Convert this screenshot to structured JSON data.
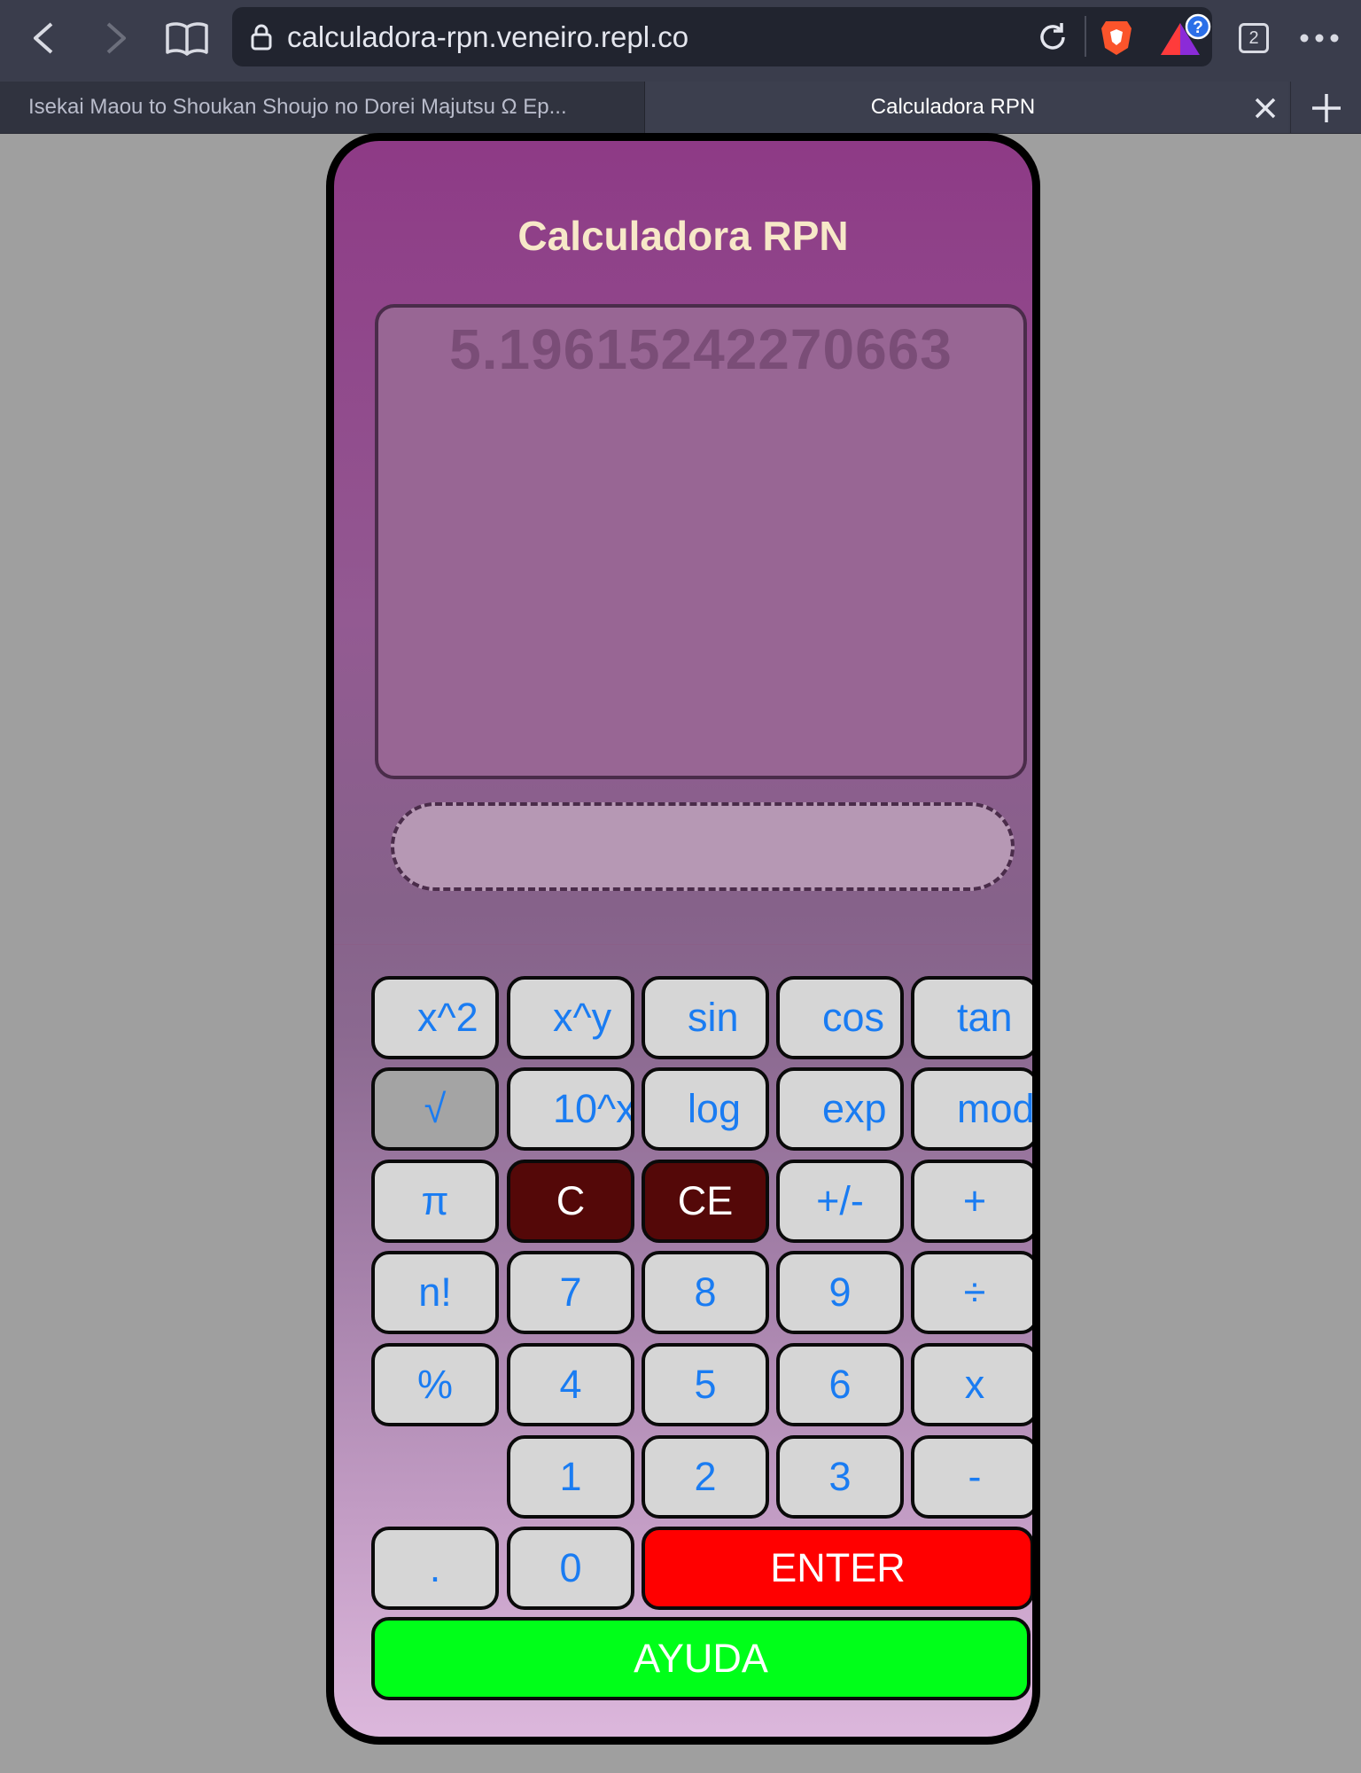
{
  "browser": {
    "url": "calculadora-rpn.veneiro.repl.co",
    "tab_count": "2",
    "tabs": [
      {
        "label": "Isekai Maou to Shoukan Shoujo no Dorei Majutsu Ω Ep...",
        "active": false
      },
      {
        "label": "Calculadora RPN",
        "active": true
      }
    ],
    "colors": {
      "toolbar": "#3a3d4c",
      "urlbar": "#21242f"
    }
  },
  "calculator": {
    "title": "Calculadora RPN",
    "display_value": "5.19615242270663",
    "input_value": "",
    "keys": {
      "row1": [
        "x^2",
        "x^y",
        "sin",
        "cos",
        "tan"
      ],
      "row2": [
        "√",
        "10^x",
        "log",
        "exp",
        "mod"
      ],
      "row3": [
        "π",
        "C",
        "CE",
        "+/-",
        "+"
      ],
      "row4": [
        "n!",
        "7",
        "8",
        "9",
        "÷"
      ],
      "row5": [
        "%",
        "4",
        "5",
        "6",
        "x"
      ],
      "row6": [
        "1",
        "2",
        "3",
        "-"
      ],
      "row7": [
        ".",
        "0",
        "ENTER"
      ],
      "help": "AYUDA"
    },
    "colors": {
      "key_text": "#1a7cf2",
      "clear_keys": "#540808",
      "enter_key": "#ff0000",
      "help_key": "#00ff19",
      "title_text": "#f7e8c8"
    }
  }
}
